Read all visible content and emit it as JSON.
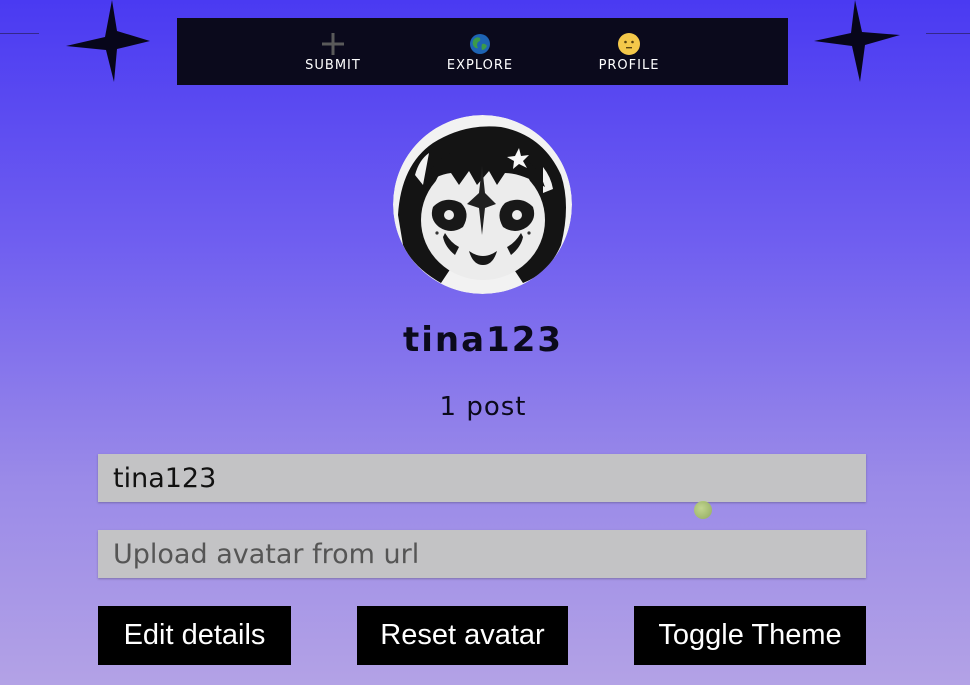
{
  "nav": {
    "items": [
      {
        "label": "SUBMIT",
        "icon": "plus-icon"
      },
      {
        "label": "EXPLORE",
        "icon": "globe-icon"
      },
      {
        "label": "PROFILE",
        "icon": "smiley-icon"
      }
    ]
  },
  "profile": {
    "username": "tina123",
    "post_count": "1 post",
    "avatar": "avatar-image"
  },
  "form": {
    "username_value": "tina123",
    "avatar_url_placeholder": "Upload avatar from url"
  },
  "buttons": {
    "edit_details": "Edit details",
    "reset_avatar": "Reset avatar",
    "toggle_theme": "Toggle Theme"
  },
  "colors": {
    "nav_bg": "#0b0a1c",
    "button_bg": "#000000",
    "input_bg": "#c3c3c5",
    "gradient_top": "#4a3af2",
    "gradient_bottom": "#b3a2e6"
  }
}
